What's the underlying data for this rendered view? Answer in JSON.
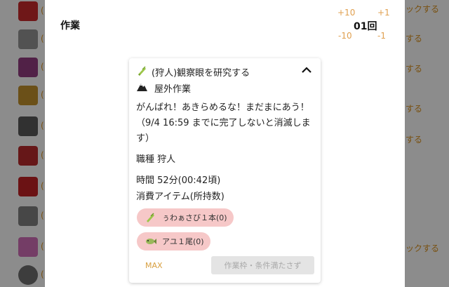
{
  "background": {
    "items": [
      {
        "icon": "tomato-icon",
        "suffix": "("
      },
      {
        "icon": "skull-icon",
        "suffix": "("
      },
      {
        "icon": "fish-icon",
        "suffix": "("
      },
      {
        "icon": "pot-icon",
        "suffix": "("
      },
      {
        "icon": "furnace-icon",
        "suffix": "("
      },
      {
        "icon": "bottle-icon",
        "suffix": "("
      },
      {
        "icon": "tomato-icon",
        "suffix": "("
      },
      {
        "icon": "barrel-icon",
        "suffix": "("
      },
      {
        "icon": "cloth-icon",
        "suffix": "("
      },
      {
        "icon": "ring-icon",
        "suffix": "("
      }
    ],
    "right_labels": [
      "ックする",
      "する",
      "する",
      "する",
      "する",
      "ックする"
    ]
  },
  "sheet": {
    "title": "作業",
    "adjust": {
      "plus10": "+10",
      "plus1": "+1",
      "minus10": "-10",
      "minus1": "-1"
    },
    "count": "01回"
  },
  "card": {
    "title": "(狩人)観察眼を研究する",
    "place": "屋外作業",
    "message": "がんばれ！あきらめるな！まだまにあう！（9/4 16:59 までに完了しないと消滅します）",
    "job": "職種 狩人",
    "time": "時間 52分(00:42頃)",
    "consume_label": "消費アイテム(所持数)",
    "items": [
      {
        "icon": "wasabi-icon",
        "label": "ぅわぁさび１本(0)"
      },
      {
        "icon": "ayu-fish-icon",
        "label": "アユ１尾(0)"
      }
    ],
    "max_label": "MAX",
    "submit_label": "作業枠・条件満たさず"
  },
  "colors": {
    "accent": "#e0a050",
    "chip": "#f6c8c8",
    "disabled": "#e4e4e4"
  }
}
